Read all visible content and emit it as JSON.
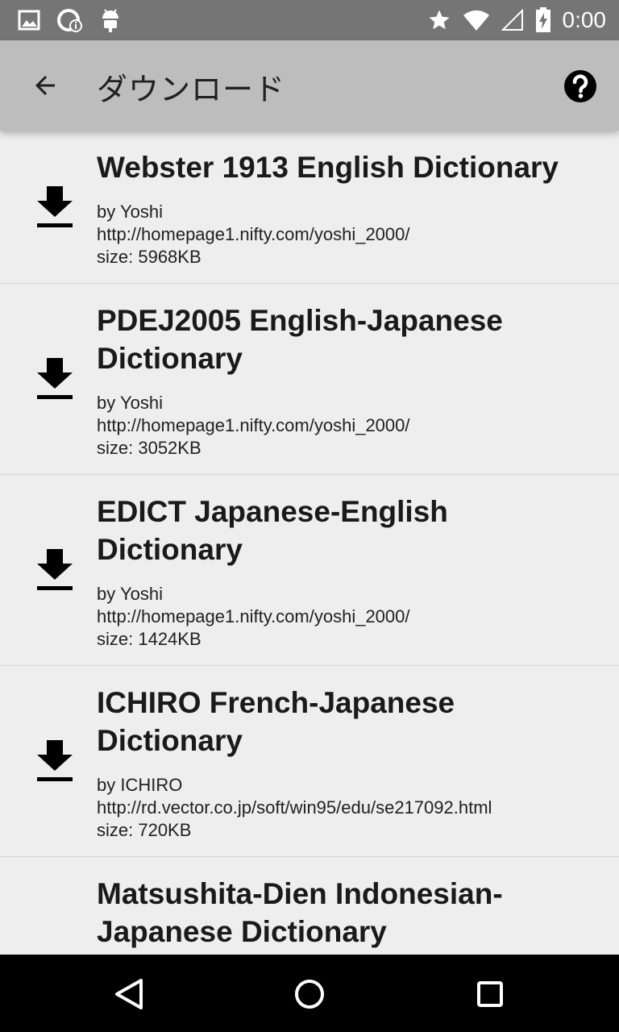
{
  "status_bar": {
    "time": "0:00",
    "left_icons": [
      "image-icon",
      "sync-info-icon",
      "android-icon"
    ],
    "right_icons": [
      "star-icon",
      "wifi-icon",
      "signal-icon",
      "battery-icon"
    ]
  },
  "appbar": {
    "title": "ダウンロード",
    "back_icon": "arrow-back-icon",
    "help_icon": "help-circle-icon"
  },
  "dictionaries": [
    {
      "title": "Webster 1913 English Dictionary",
      "author": "by Yoshi",
      "url": "http://homepage1.nifty.com/yoshi_2000/",
      "size": "size: 5968KB"
    },
    {
      "title": "PDEJ2005 English-Japanese Dictionary",
      "author": "by Yoshi",
      "url": "http://homepage1.nifty.com/yoshi_2000/",
      "size": "size: 3052KB"
    },
    {
      "title": "EDICT Japanese-English Dictionary",
      "author": "by Yoshi",
      "url": "http://homepage1.nifty.com/yoshi_2000/",
      "size": "size: 1424KB"
    },
    {
      "title": "ICHIRO French-Japanese Dictionary",
      "author": "by ICHIRO",
      "url": "http://rd.vector.co.jp/soft/win95/edu/se217092.html",
      "size": "size: 720KB"
    },
    {
      "title": "Matsushita-Dien Indonesian-Japanese Dictionary",
      "author": "",
      "url": "",
      "size": ""
    }
  ],
  "navbar": {
    "icons": [
      "back-triangle-icon",
      "home-circle-icon",
      "recents-square-icon"
    ]
  }
}
